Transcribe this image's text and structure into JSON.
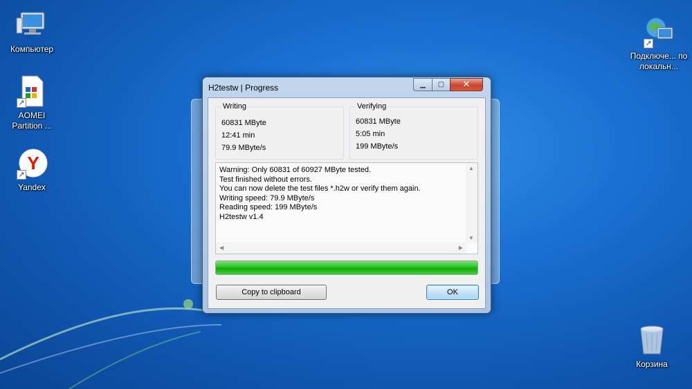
{
  "desktop": {
    "icons": [
      {
        "label": "Компьютер",
        "icon": "computer-icon"
      },
      {
        "label": "AOMEI Partition ...",
        "icon": "app-window-icon"
      },
      {
        "label": "Yandex",
        "icon": "yandex-browser-icon"
      },
      {
        "label": "Подключе... по локальн...",
        "icon": "network-connection-icon"
      },
      {
        "label": "Корзина",
        "icon": "recycle-bin-icon"
      }
    ]
  },
  "dialog": {
    "title": "H2testw | Progress",
    "writing": {
      "heading": "Writing",
      "size": "60831 MByte",
      "time": "12:41 min",
      "speed": "79.9 MByte/s"
    },
    "verifying": {
      "heading": "Verifying",
      "size": "60831 MByte",
      "time": "5:05 min",
      "speed": "199 MByte/s"
    },
    "log_lines": [
      "Warning: Only 60831 of 60927 MByte tested.",
      "Test finished without errors.",
      "You can now delete the test files *.h2w or verify them again.",
      "Writing speed: 79.9 MByte/s",
      "Reading speed: 199 MByte/s",
      "H2testw v1.4"
    ],
    "progress_fraction": 1.0,
    "progress_color": "#22c11a",
    "copy_label": "Copy to clipboard",
    "ok_label": "OK"
  }
}
